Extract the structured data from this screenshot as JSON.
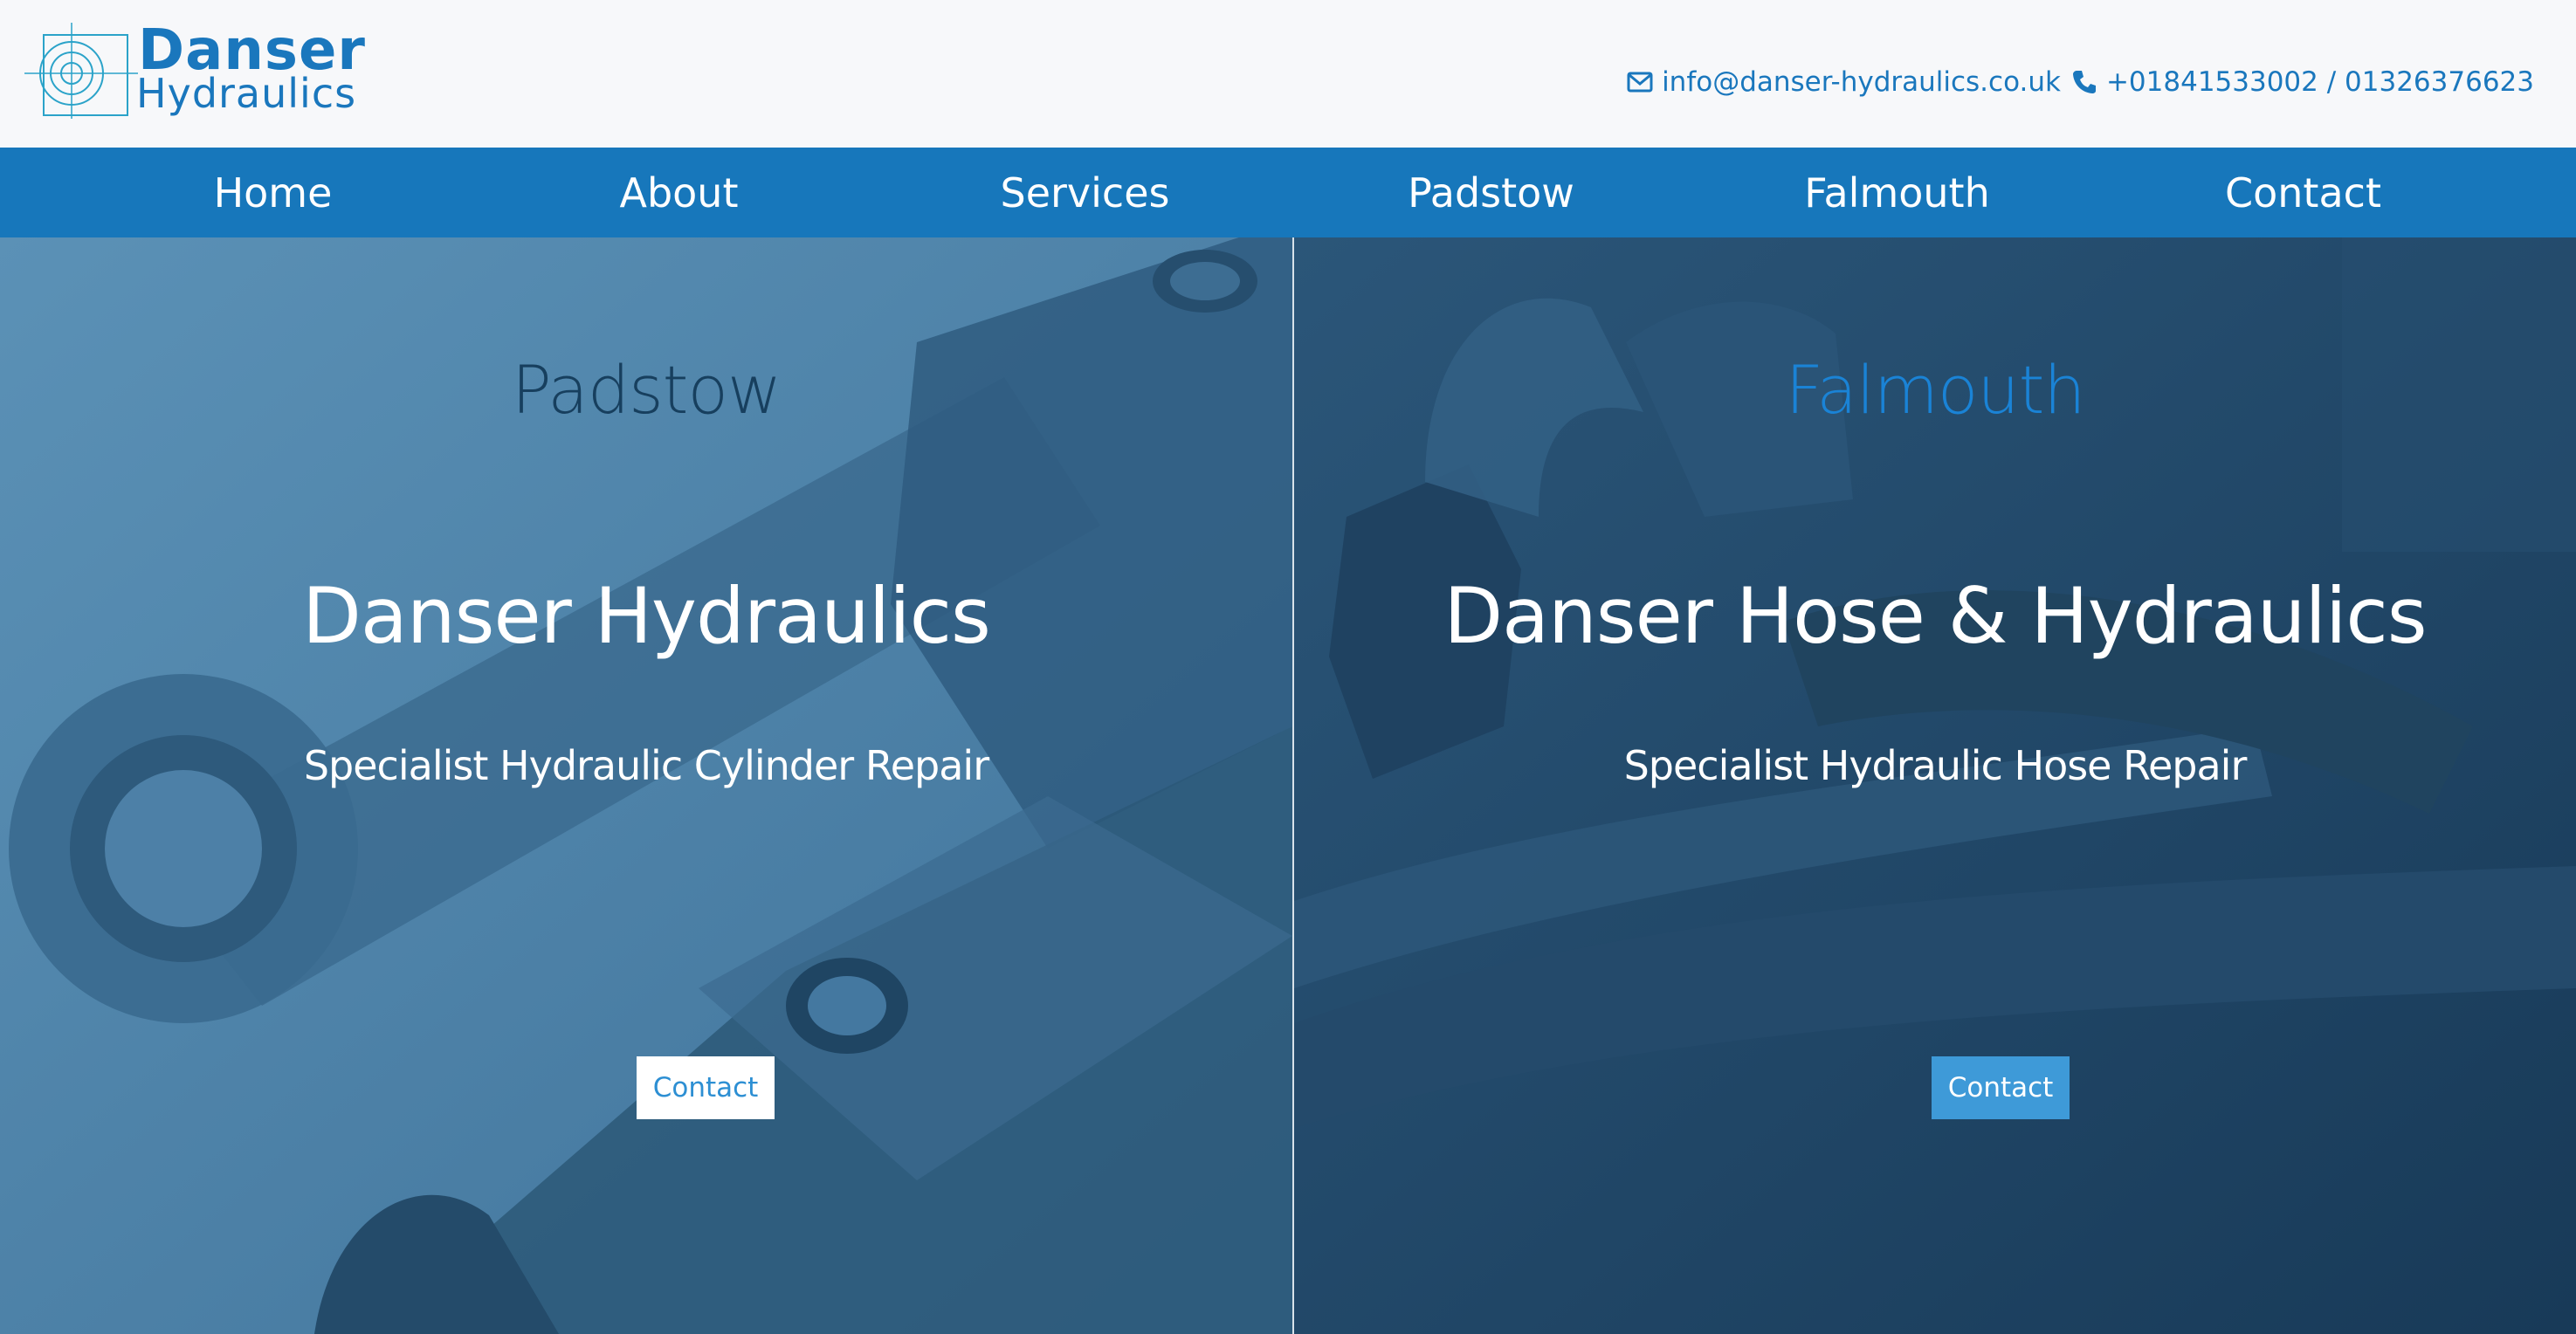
{
  "brand": {
    "line1": "Danser",
    "line2": "Hydraulics",
    "color": "#1a77bd"
  },
  "header": {
    "email": "info@danser-hydraulics.co.uk",
    "phone": "+01841533002 / 01326376623",
    "email_icon": "envelope-icon",
    "phone_icon": "phone-icon"
  },
  "nav": {
    "items": [
      {
        "label": "Home"
      },
      {
        "label": "About"
      },
      {
        "label": "Services"
      },
      {
        "label": "Padstow"
      },
      {
        "label": "Falmouth"
      },
      {
        "label": "Contact"
      }
    ],
    "background": "#1777bb"
  },
  "panels": {
    "left": {
      "location": "Padstow",
      "title": "Danser Hydraulics",
      "subtitle": "Specialist Hydraulic Cylinder Repair",
      "button": "Contact"
    },
    "right": {
      "location": "Falmouth",
      "title": "Danser Hose & Hydraulics",
      "subtitle": "Specialist Hydraulic Hose Repair",
      "button": "Contact"
    }
  }
}
